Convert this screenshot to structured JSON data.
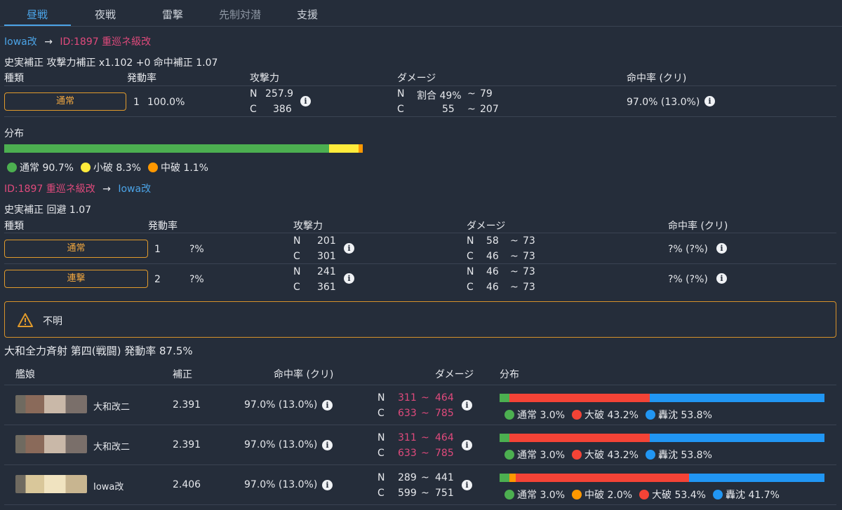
{
  "tabs": [
    "昼戦",
    "夜戦",
    "雷撃",
    "先制対潜",
    "支援"
  ],
  "colors": {
    "accent": "#4ba3e6",
    "enemy": "#e04a7c",
    "normal": "#4caf50",
    "shouha": "#ffeb3b",
    "chuuha": "#ff9800",
    "taiha": "#f44336",
    "sunk": "#2196f3",
    "orange_border": "#e09a2c"
  },
  "attack1": {
    "from": "Iowa改",
    "arrow": "→",
    "to": "ID:1897 重巡ネ級改",
    "correction": "史実補正 攻撃力補正 x1.102 +0 命中補正 1.07",
    "headers": {
      "kind": "種類",
      "rate": "発動率",
      "power": "攻撃力",
      "damage": "ダメージ",
      "hit": "命中率 (クリ)"
    },
    "row": {
      "button": "通常",
      "count": "1",
      "rate": "100.0%",
      "power_n_label": "N",
      "power_n": "257.9",
      "power_c_label": "C",
      "power_c": "386",
      "dmg_n_label": "N",
      "dmg_n": "割合 49%",
      "dmg_n_tilde": "~",
      "dmg_n_max": "79",
      "dmg_c_label": "C",
      "dmg_c": "55",
      "dmg_c_tilde": "~",
      "dmg_c_max": "207",
      "hit": "97.0%  (13.0%)"
    },
    "distribution_label": "分布",
    "distribution": [
      {
        "label": "通常 90.7%",
        "value": 90.7,
        "color": "#4caf50"
      },
      {
        "label": "小破 8.3%",
        "value": 8.3,
        "color": "#ffeb3b"
      },
      {
        "label": "中破 1.1%",
        "value": 1.1,
        "color": "#ff9800"
      }
    ]
  },
  "attack2": {
    "from": "ID:1897 重巡ネ級改",
    "arrow": "→",
    "to": "Iowa改",
    "correction": "史実補正 回避 1.07",
    "headers": {
      "kind": "種類",
      "rate": "発動率",
      "power": "攻撃力",
      "damage": "ダメージ",
      "hit": "命中率 (クリ)"
    },
    "rows": [
      {
        "button": "通常",
        "count": "1",
        "rate": "?%",
        "power_n_label": "N",
        "power_n": "201",
        "power_c_label": "C",
        "power_c": "301",
        "dmg_n_label": "N",
        "dmg_n": "58",
        "dmg_n_tilde": "~",
        "dmg_n_max": "73",
        "dmg_c_label": "C",
        "dmg_c": "46",
        "dmg_c_tilde": "~",
        "dmg_c_max": "73",
        "hit": "?%  (?%)"
      },
      {
        "button": "連撃",
        "count": "2",
        "rate": "?%",
        "power_n_label": "N",
        "power_n": "241",
        "power_c_label": "C",
        "power_c": "361",
        "dmg_n_label": "N",
        "dmg_n": "46",
        "dmg_n_tilde": "~",
        "dmg_n_max": "73",
        "dmg_c_label": "C",
        "dmg_c": "46",
        "dmg_c_tilde": "~",
        "dmg_c_max": "73",
        "hit": "?%  (?%)"
      }
    ]
  },
  "warning": {
    "icon": "warning-icon",
    "text": "不明"
  },
  "special": {
    "title": "大和全力斉射 第四(戦闘) 発動率 87.5%",
    "headers": {
      "ship": "艦娘",
      "mod": "補正",
      "hit": "命中率 (クリ)",
      "damage": "ダメージ",
      "dist": "分布"
    },
    "rows": [
      {
        "name": "大和改二",
        "mod": "2.391",
        "hit": "97.0%  (13.0%)",
        "n_label": "N",
        "n_min": "311",
        "n_tilde": "~",
        "n_max": "464",
        "c_label": "C",
        "c_min": "633",
        "c_tilde": "~",
        "c_max": "785",
        "dmg_color": "#e04a7c",
        "distribution": [
          {
            "label": "通常 3.0%",
            "value": 3.0,
            "color": "#4caf50"
          },
          {
            "label": "大破 43.2%",
            "value": 43.2,
            "color": "#f44336"
          },
          {
            "label": "轟沈 53.8%",
            "value": 53.8,
            "color": "#2196f3"
          }
        ]
      },
      {
        "name": "大和改二",
        "mod": "2.391",
        "hit": "97.0%  (13.0%)",
        "n_label": "N",
        "n_min": "311",
        "n_tilde": "~",
        "n_max": "464",
        "c_label": "C",
        "c_min": "633",
        "c_tilde": "~",
        "c_max": "785",
        "dmg_color": "#e04a7c",
        "distribution": [
          {
            "label": "通常 3.0%",
            "value": 3.0,
            "color": "#4caf50"
          },
          {
            "label": "大破 43.2%",
            "value": 43.2,
            "color": "#f44336"
          },
          {
            "label": "轟沈 53.8%",
            "value": 53.8,
            "color": "#2196f3"
          }
        ]
      },
      {
        "name": "Iowa改",
        "mod": "2.406",
        "hit": "97.0%  (13.0%)",
        "n_label": "N",
        "n_min": "289",
        "n_tilde": "~",
        "n_max": "441",
        "c_label": "C",
        "c_min": "599",
        "c_tilde": "~",
        "c_max": "751",
        "dmg_color": "#e6e8ec",
        "distribution": [
          {
            "label": "通常 3.0%",
            "value": 3.0,
            "color": "#4caf50"
          },
          {
            "label": "中破 2.0%",
            "value": 2.0,
            "color": "#ff9800"
          },
          {
            "label": "大破 53.4%",
            "value": 53.4,
            "color": "#f44336"
          },
          {
            "label": "轟沈 41.7%",
            "value": 41.7,
            "color": "#2196f3"
          }
        ]
      }
    ]
  }
}
